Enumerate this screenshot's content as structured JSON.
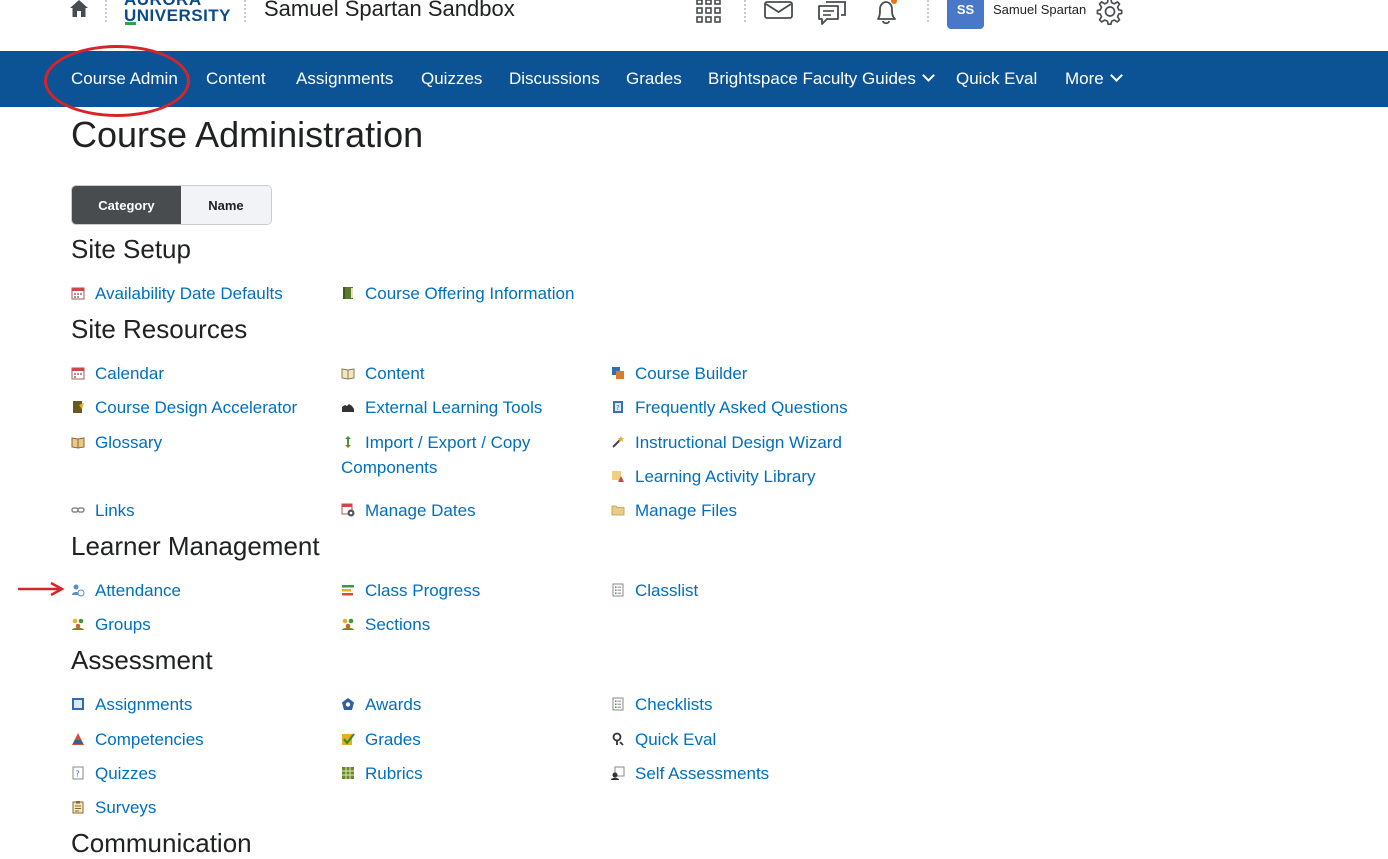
{
  "header": {
    "logo_line1": "AURORA",
    "logo_line2": "UNIVERSITY",
    "site_title": "Samuel Spartan Sandbox",
    "avatar_initials": "SS",
    "user_name": "Samuel Spartan"
  },
  "nav": {
    "items": [
      {
        "label": "Course Admin"
      },
      {
        "label": "Content"
      },
      {
        "label": "Assignments"
      },
      {
        "label": "Quizzes"
      },
      {
        "label": "Discussions"
      },
      {
        "label": "Grades"
      },
      {
        "label": "Brightspace Faculty Guides"
      },
      {
        "label": "Quick Eval"
      },
      {
        "label": "More"
      }
    ]
  },
  "page": {
    "title": "Course Administration",
    "toggle": {
      "category": "Category",
      "name": "Name"
    }
  },
  "sections": {
    "site_setup": {
      "title": "Site Setup",
      "links": [
        "Availability Date Defaults",
        "Course Offering Information"
      ]
    },
    "site_resources": {
      "title": "Site Resources",
      "links": [
        "Calendar",
        "Content",
        "Course Builder",
        "Course Design Accelerator",
        "External Learning Tools",
        "Frequently Asked Questions",
        "Glossary",
        "Import / Export / Copy Components",
        "Instructional Design Wizard",
        "Learning Activity Library",
        "Links",
        "Manage Dates",
        "Manage Files"
      ]
    },
    "learner_management": {
      "title": "Learner Management",
      "links": [
        "Attendance",
        "Class Progress",
        "Classlist",
        "Groups",
        "Sections"
      ]
    },
    "assessment": {
      "title": "Assessment",
      "links": [
        "Assignments",
        "Awards",
        "Checklists",
        "Competencies",
        "Grades",
        "Quick Eval",
        "Quizzes",
        "Rubrics",
        "Self Assessments",
        "Surveys"
      ]
    },
    "communication": {
      "title": "Communication"
    }
  },
  "colors": {
    "nav_bg": "#0c5395",
    "link": "#006fbf",
    "annotation": "#d8232a",
    "avatar": "#4a78c8"
  },
  "icons": [
    "home-icon",
    "waffle-icon",
    "mail-icon",
    "chat-icon",
    "bell-icon",
    "gear-icon"
  ]
}
